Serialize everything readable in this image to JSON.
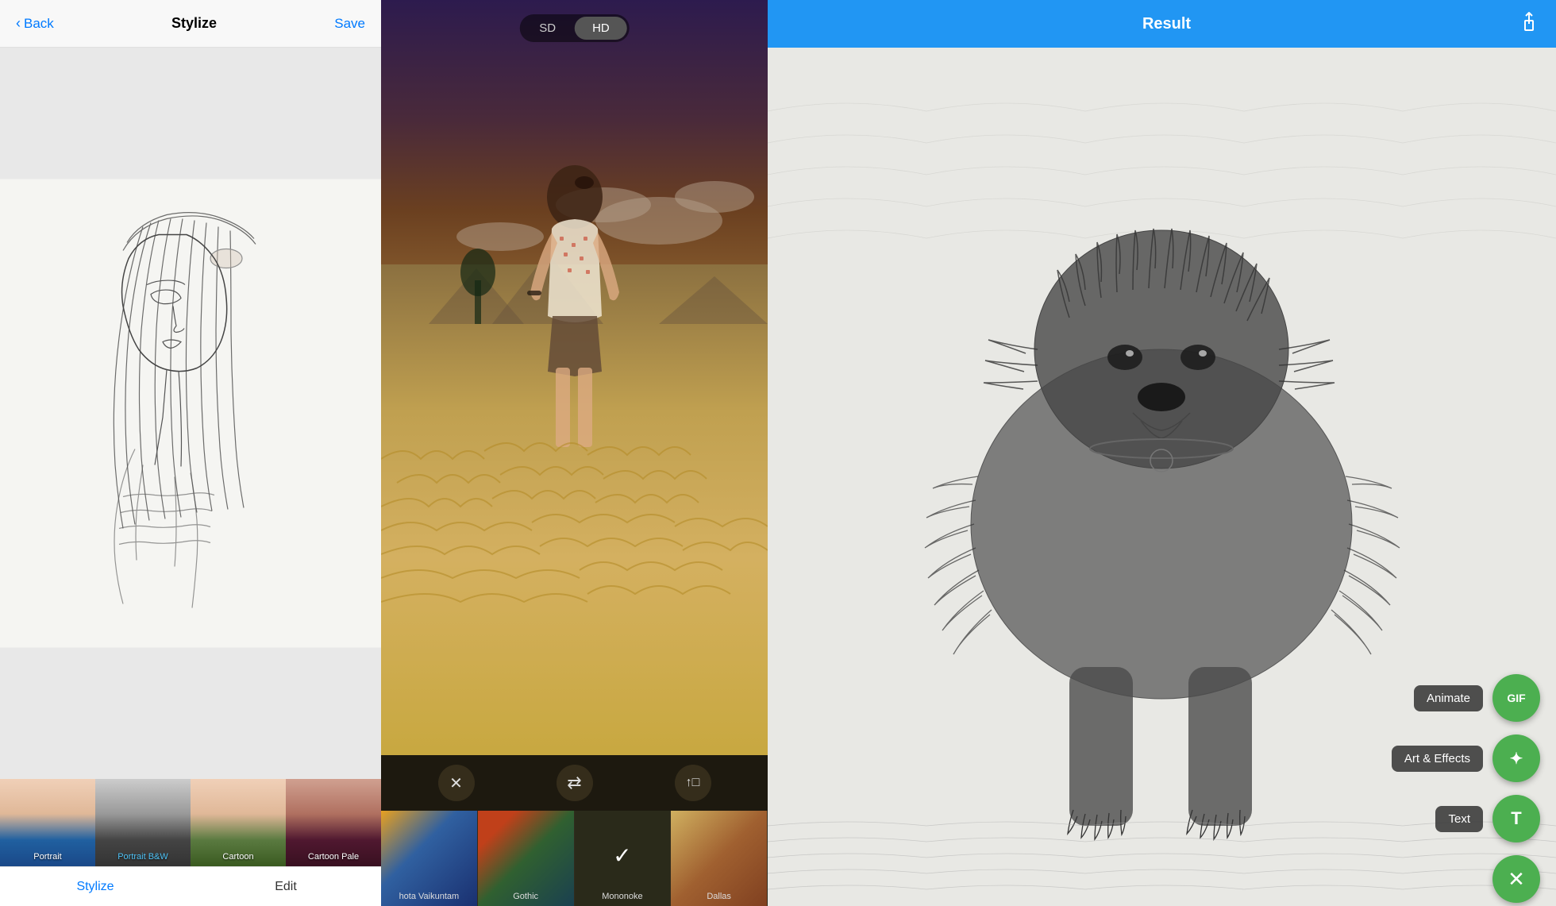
{
  "panel1": {
    "header": {
      "back_label": "Back",
      "title": "Stylize",
      "save_label": "Save"
    },
    "thumbnails": [
      {
        "label": "Portrait",
        "style": "portrait",
        "selected": false
      },
      {
        "label": "Portrait B&W",
        "style": "portrait_bw",
        "selected": false
      },
      {
        "label": "Cartoon",
        "style": "cartoon",
        "selected": false
      },
      {
        "label": "Cartoon Pale",
        "style": "cartoon_pale",
        "selected": false
      }
    ],
    "bottom_tabs": [
      {
        "label": "Stylize",
        "active": true
      },
      {
        "label": "Edit",
        "active": false
      }
    ]
  },
  "panel2": {
    "toggle": {
      "sd_label": "SD",
      "hd_label": "HD",
      "active": "HD"
    },
    "controls": [
      {
        "icon": "✕",
        "name": "close"
      },
      {
        "icon": "⚙",
        "name": "settings"
      },
      {
        "icon": "↑",
        "name": "share"
      }
    ],
    "filters": [
      {
        "label": "hota Vaikuntam",
        "style": "fb1",
        "selected": false
      },
      {
        "label": "Gothic",
        "style": "fb2",
        "selected": false
      },
      {
        "label": "Mononoke",
        "style": "fb3",
        "selected": true
      },
      {
        "label": "Dallas",
        "style": "fb4",
        "selected": false
      }
    ]
  },
  "panel3": {
    "header": {
      "title": "Result",
      "share_icon": "share"
    },
    "fab_items": [
      {
        "label": "Animate",
        "icon": "GIF",
        "name": "animate"
      },
      {
        "label": "Art & Effects",
        "icon": "✦",
        "name": "art-effects"
      },
      {
        "label": "Text",
        "icon": "T",
        "name": "text"
      }
    ],
    "fab_close_icon": "✕"
  }
}
